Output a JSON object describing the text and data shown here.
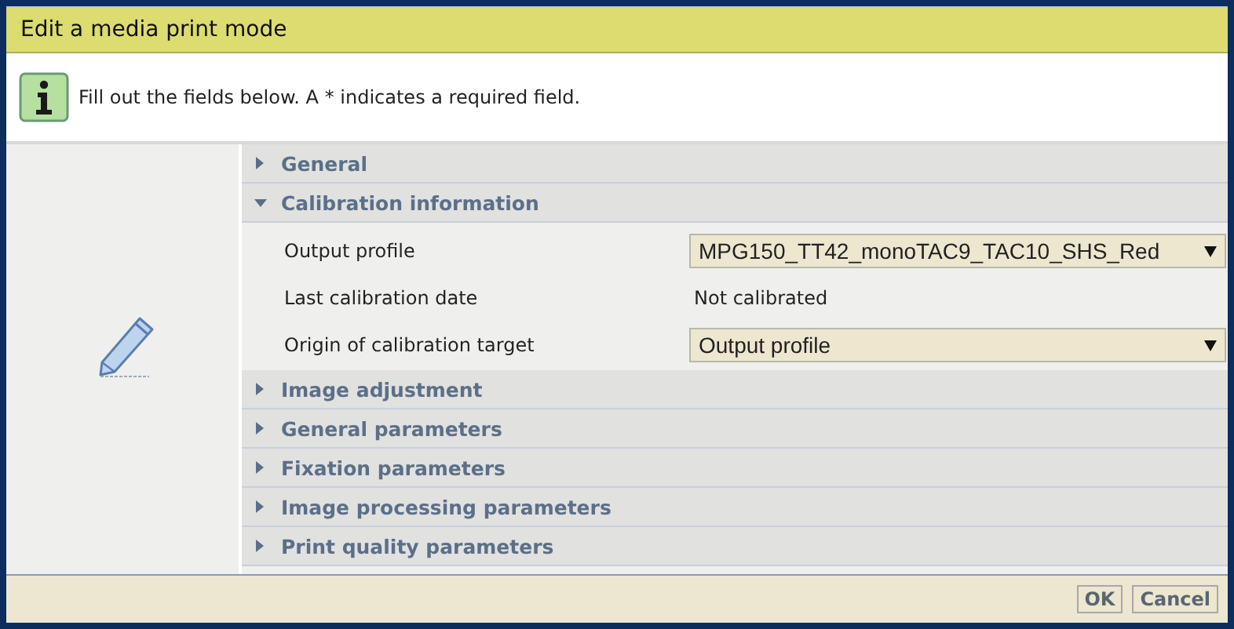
{
  "dialog": {
    "title": "Edit a media print mode"
  },
  "info": {
    "message": "Fill out the fields below. A * indicates a required field."
  },
  "sections": [
    {
      "label": "General",
      "expanded": false
    },
    {
      "label": "Calibration information",
      "expanded": true,
      "fields": [
        {
          "label": "Output profile",
          "kind": "select",
          "value": "MPG150_TT42_monoTAC9_TAC10_SHS_Red"
        },
        {
          "label": "Last calibration date",
          "kind": "text",
          "value": "Not calibrated"
        },
        {
          "label": "Origin of calibration target",
          "kind": "select",
          "value": "Output profile"
        }
      ]
    },
    {
      "label": "Image adjustment",
      "expanded": false
    },
    {
      "label": "General parameters",
      "expanded": false
    },
    {
      "label": "Fixation parameters",
      "expanded": false
    },
    {
      "label": "Image processing parameters",
      "expanded": false
    },
    {
      "label": "Print quality parameters",
      "expanded": false
    }
  ],
  "buttons": [
    "OK",
    "Cancel"
  ]
}
